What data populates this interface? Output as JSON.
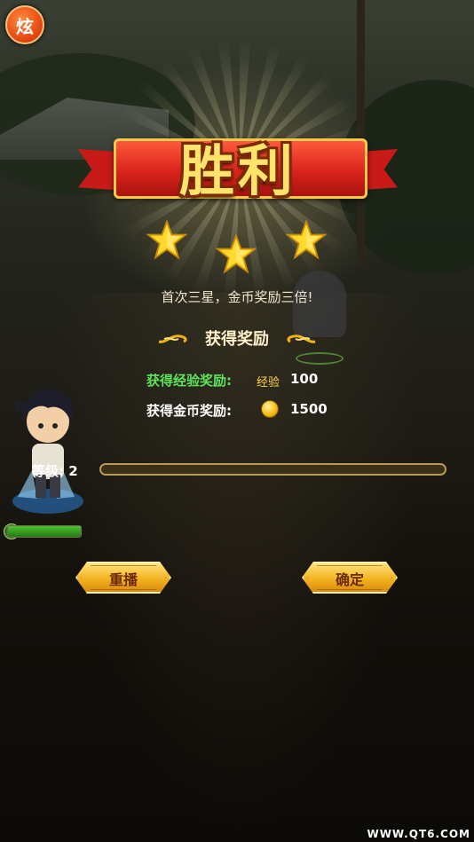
{
  "badge": {
    "label": "炫"
  },
  "result": {
    "title": "胜利",
    "stars_earned": 3,
    "first_star_message": "首次三星，金币奖励三倍!",
    "reward_header": "获得奖励"
  },
  "rewards": {
    "exp_label": "获得经验奖励:",
    "exp_unit": "经验",
    "exp_value": "100",
    "gold_label": "获得金币奖励:",
    "gold_value": "1500"
  },
  "level": {
    "label": "等级:",
    "value": "2",
    "progress": 0.0
  },
  "hero": {
    "hp_progress": 1.0
  },
  "buttons": {
    "replay": "重播",
    "confirm": "确定"
  },
  "watermark": "WWW.QT6.COM",
  "colors": {
    "exp_label": "#5fe35a",
    "button": "#f3b321",
    "banner": "#d9231c",
    "title": "#ffe36a"
  }
}
